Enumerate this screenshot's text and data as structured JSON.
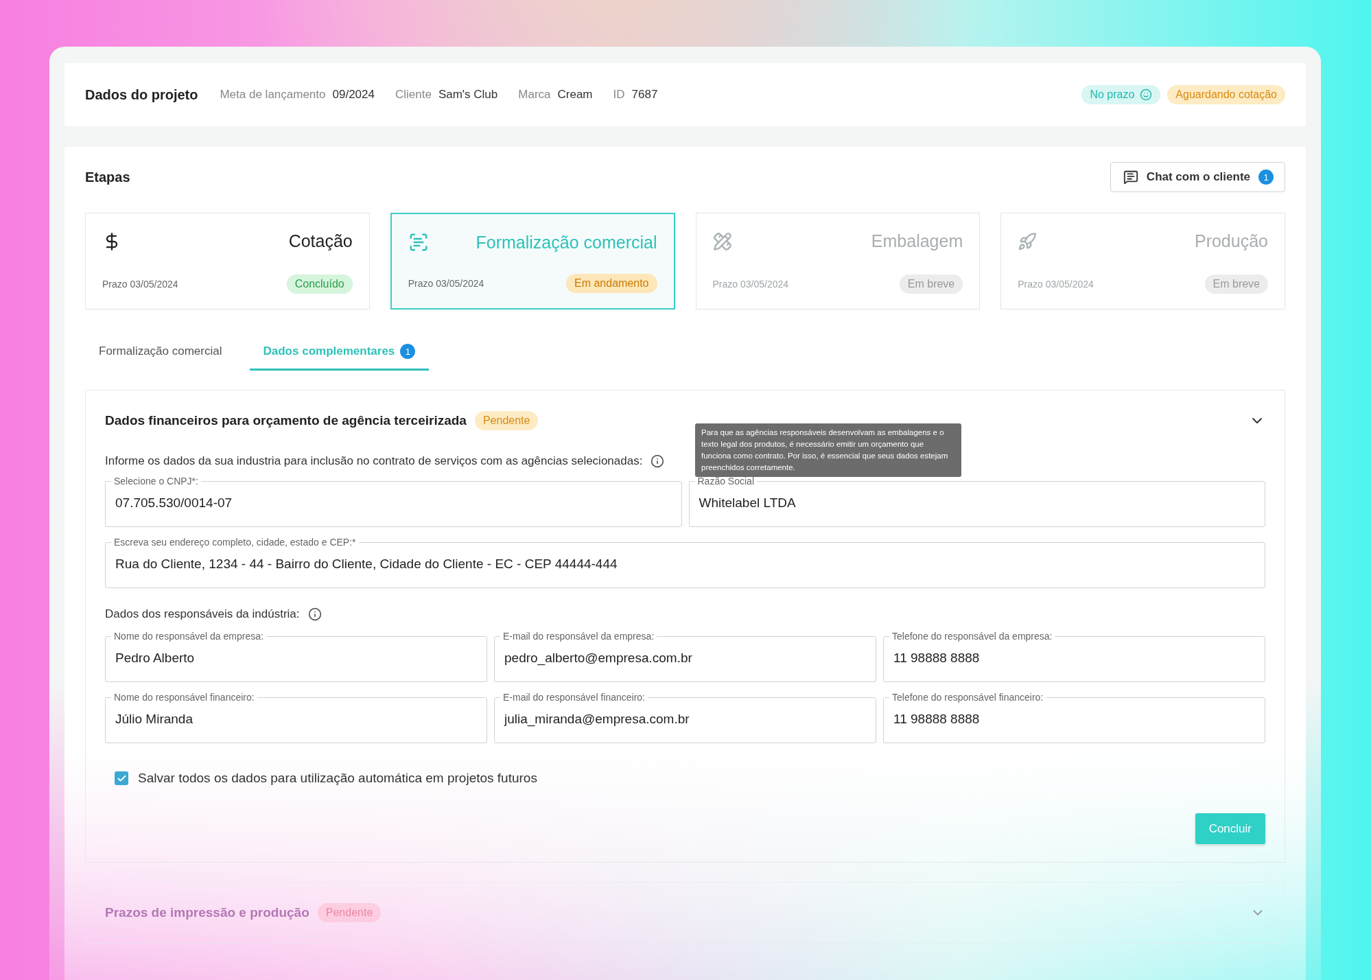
{
  "project": {
    "title": "Dados do projeto",
    "meta": [
      {
        "label": "Meta de lançamento",
        "value": "09/2024"
      },
      {
        "label": "Cliente",
        "value": "Sam's Club"
      },
      {
        "label": "Marca",
        "value": "Cream"
      },
      {
        "label": "ID",
        "value": "7687"
      }
    ],
    "badges": [
      {
        "text": "No prazo",
        "kind": "on_time"
      },
      {
        "text": "Aguardando cotação",
        "kind": "waiting"
      }
    ]
  },
  "stages_section": {
    "title": "Etapas",
    "chat_button": {
      "label": "Chat com o cliente",
      "count": "1"
    }
  },
  "stages": [
    {
      "kind": "quote",
      "title": "Cotação",
      "deadline": "Prazo 03/05/2024",
      "status": {
        "text": "Concluído",
        "kind": "done"
      },
      "selected": false
    },
    {
      "kind": "formal",
      "title": "Formalização comercial",
      "deadline": "Prazo 03/05/2024",
      "status": {
        "text": "Em andamento",
        "kind": "progress"
      },
      "selected": true
    },
    {
      "kind": "packaging",
      "title": "Embalagem",
      "deadline": "Prazo 03/05/2024",
      "status": {
        "text": "Em breve",
        "kind": "soon"
      },
      "selected": false
    },
    {
      "kind": "production",
      "title": "Produção",
      "deadline": "Prazo 03/05/2024",
      "status": {
        "text": "Em breve",
        "kind": "soon"
      },
      "selected": false
    }
  ],
  "tabs": [
    {
      "label": "Formalização comercial",
      "selected": false
    },
    {
      "label": "Dados complementares",
      "selected": true,
      "count": "1"
    }
  ],
  "sections": [
    {
      "title": "Dados financeiros para orçamento de agência terceirizada",
      "status": "Pendente",
      "expanded": true,
      "intro": "Informe os dados da sua industria para inclusão no contrato de serviços com as agências selecionadas:",
      "tooltip": "Para que as agências responsáveis desenvolvam as embalagens e o texto legal dos produtos, é necessário emitir um orçamento que funciona como contrato. Por isso, é essencial que seus dados estejam preenchidos corretamente.",
      "company_fields": [
        {
          "label": "Selecione o CNPJ*:",
          "value": "07.705.530/0014-07"
        },
        {
          "label": "Razão Social",
          "value": "Whitelabel LTDA"
        }
      ],
      "address_field": {
        "label": "Escreva seu endereço completo, cidade, estado e CEP:*",
        "value": "Rua do Cliente, 1234 - 44 - Bairro do Cliente, Cidade do Cliente - EC - CEP 44444-444"
      },
      "contacts_label": "Dados dos responsáveis da indústria:",
      "contact_fields": [
        {
          "label": "Nome do responsável da empresa:",
          "value": "Pedro Alberto"
        },
        {
          "label": "E-mail do responsável  da empresa:",
          "value": "pedro_alberto@empresa.com.br"
        },
        {
          "label": "Telefone do responsável  da empresa:",
          "value": "11 98888 8888"
        },
        {
          "label": "Nome do responsável financeiro:",
          "value": "Júlio Miranda"
        },
        {
          "label": "E-mail do responsável financeiro:",
          "value": "julia_miranda@empresa.com.br"
        },
        {
          "label": "Telefone do responsável financeiro:",
          "value": "11 98888 8888"
        }
      ],
      "save": {
        "label": "Salvar todos os dados para utilização automática em projetos futuros",
        "checked": true
      },
      "submit": "Concluir"
    },
    {
      "title": "Prazos de impressão e produção",
      "status": "Pendente",
      "expanded": false
    }
  ]
}
